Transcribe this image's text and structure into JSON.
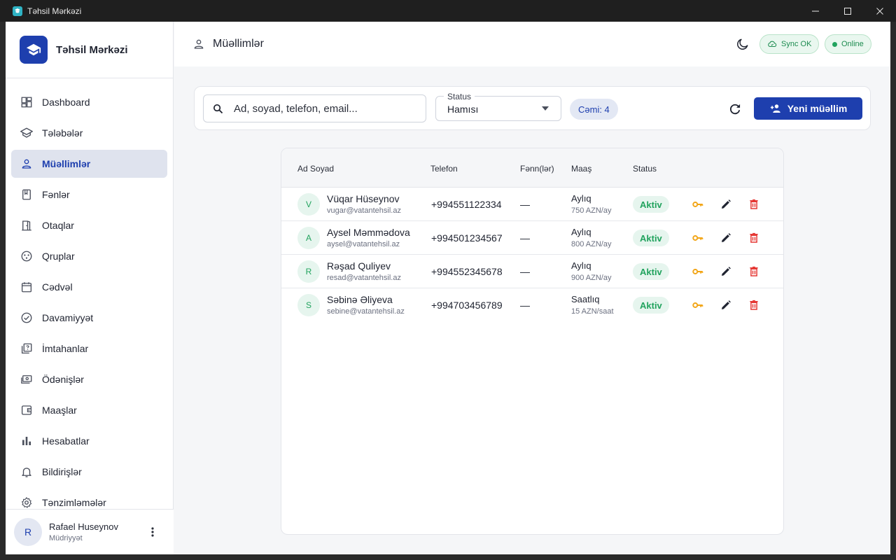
{
  "window": {
    "title": "Təhsil Mərkəzi"
  },
  "sidebar": {
    "brand": "Təhsil Mərkəzi",
    "items": [
      {
        "label": "Dashboard",
        "icon": "dashboard-icon"
      },
      {
        "label": "Tələbələr",
        "icon": "school-icon"
      },
      {
        "label": "Müəllimlər",
        "icon": "person-icon",
        "active": true
      },
      {
        "label": "Fənlər",
        "icon": "book-icon"
      },
      {
        "label": "Otaqlar",
        "icon": "door-icon"
      },
      {
        "label": "Qruplar",
        "icon": "groups-icon"
      },
      {
        "label": "Cədvəl",
        "icon": "calendar-icon"
      },
      {
        "label": "Davamiyyət",
        "icon": "check-circle-icon"
      },
      {
        "label": "İmtahanlar",
        "icon": "quiz-icon"
      },
      {
        "label": "Ödənişlər",
        "icon": "payments-icon"
      },
      {
        "label": "Maaşlar",
        "icon": "wallet-icon"
      },
      {
        "label": "Hesabatlar",
        "icon": "bar-chart-icon"
      },
      {
        "label": "Bildirişlər",
        "icon": "bell-icon"
      },
      {
        "label": "Tənzimləmələr",
        "icon": "gear-icon"
      }
    ],
    "user": {
      "initial": "R",
      "name": "Rafael Huseynov",
      "role": "Müdriyyət"
    }
  },
  "header": {
    "title": "Müəllimlər",
    "sync_label": "Sync OK",
    "online_label": "Online"
  },
  "toolbar": {
    "search_placeholder": "Ad, soyad, telefon, email...",
    "status_legend": "Status",
    "status_value": "Hamısı",
    "count_label": "Cəmi: 4",
    "new_button_label": "Yeni müəllim"
  },
  "table": {
    "columns": [
      "Ad Soyad",
      "Telefon",
      "Fənn(lər)",
      "Maaş",
      "Status"
    ],
    "rows": [
      {
        "initial": "V",
        "name": "Vüqar Hüseynov",
        "email": "vugar@vatantehsil.az",
        "phone": "+994551122334",
        "subjects": "—",
        "salary_type": "Aylıq",
        "salary_amount": "750 AZN/ay",
        "status": "Aktiv"
      },
      {
        "initial": "A",
        "name": "Aysel Məmmədova",
        "email": "aysel@vatantehsil.az",
        "phone": "+994501234567",
        "subjects": "—",
        "salary_type": "Aylıq",
        "salary_amount": "800 AZN/ay",
        "status": "Aktiv"
      },
      {
        "initial": "R",
        "name": "Rəşad Quliyev",
        "email": "resad@vatantehsil.az",
        "phone": "+994552345678",
        "subjects": "—",
        "salary_type": "Aylıq",
        "salary_amount": "900 AZN/ay",
        "status": "Aktiv"
      },
      {
        "initial": "S",
        "name": "Səbinə Əliyeva",
        "email": "sebine@vatantehsil.az",
        "phone": "+994703456789",
        "subjects": "—",
        "salary_type": "Saatlıq",
        "salary_amount": "15 AZN/saat",
        "status": "Aktiv"
      }
    ]
  },
  "colors": {
    "primary": "#1e3fae",
    "success": "#22a35e",
    "key": "#f2a516",
    "delete": "#e53935"
  }
}
